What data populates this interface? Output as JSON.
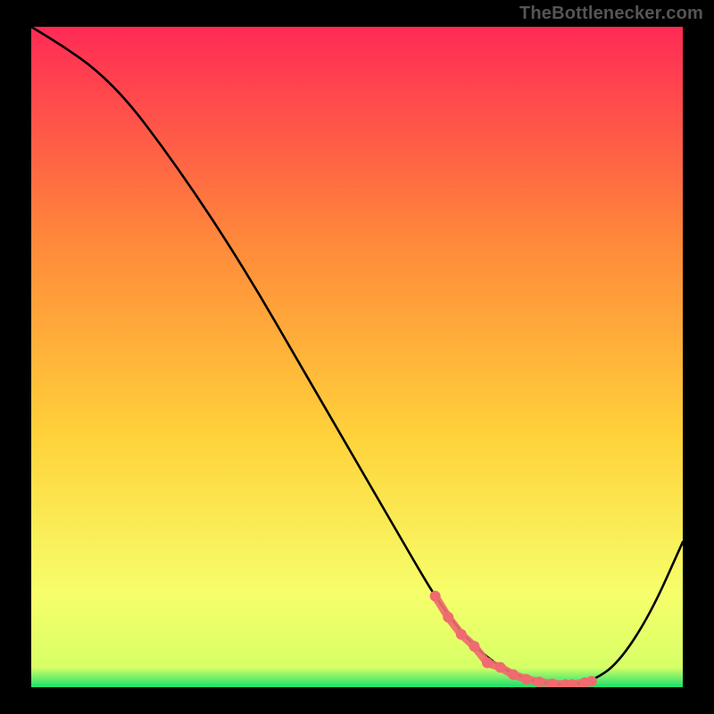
{
  "watermark": "TheBottlenecker.com",
  "colors": {
    "top": "#ff2a55",
    "mid1": "#ff6a3f",
    "mid2": "#ffd23a",
    "mid3": "#f8ff56",
    "bottom": "#18e06e",
    "curve": "#000000",
    "marker": "#ef6b6f",
    "frame_bg": "#000000"
  },
  "chart_data": {
    "type": "line",
    "title": "",
    "xlabel": "",
    "ylabel": "",
    "xlim": [
      0,
      100
    ],
    "ylim": [
      0,
      100
    ],
    "curve": {
      "x": [
        0,
        5,
        10,
        15,
        20,
        25,
        30,
        35,
        40,
        45,
        50,
        55,
        60,
        62,
        65,
        68,
        72,
        76,
        80,
        83,
        86,
        90,
        95,
        100
      ],
      "y": [
        100,
        97,
        93.5,
        88.5,
        82,
        75,
        67.5,
        59.5,
        51,
        42.5,
        34,
        25.5,
        17,
        13.8,
        9.6,
        6.2,
        3,
        1.2,
        0.5,
        0.4,
        0.9,
        3.5,
        11,
        22
      ]
    },
    "markers": {
      "name": "highlighted-region",
      "points": [
        {
          "x": 62,
          "y": 13.8
        },
        {
          "x": 64,
          "y": 10.6
        },
        {
          "x": 66,
          "y": 8.0
        },
        {
          "x": 68,
          "y": 6.2
        },
        {
          "x": 70,
          "y": 3.7
        },
        {
          "x": 72,
          "y": 3.0
        },
        {
          "x": 74,
          "y": 1.9
        },
        {
          "x": 76,
          "y": 1.2
        },
        {
          "x": 78,
          "y": 0.8
        },
        {
          "x": 80,
          "y": 0.5
        },
        {
          "x": 82,
          "y": 0.4
        },
        {
          "x": 83,
          "y": 0.4
        },
        {
          "x": 85,
          "y": 0.7
        },
        {
          "x": 86,
          "y": 0.9
        }
      ]
    }
  }
}
